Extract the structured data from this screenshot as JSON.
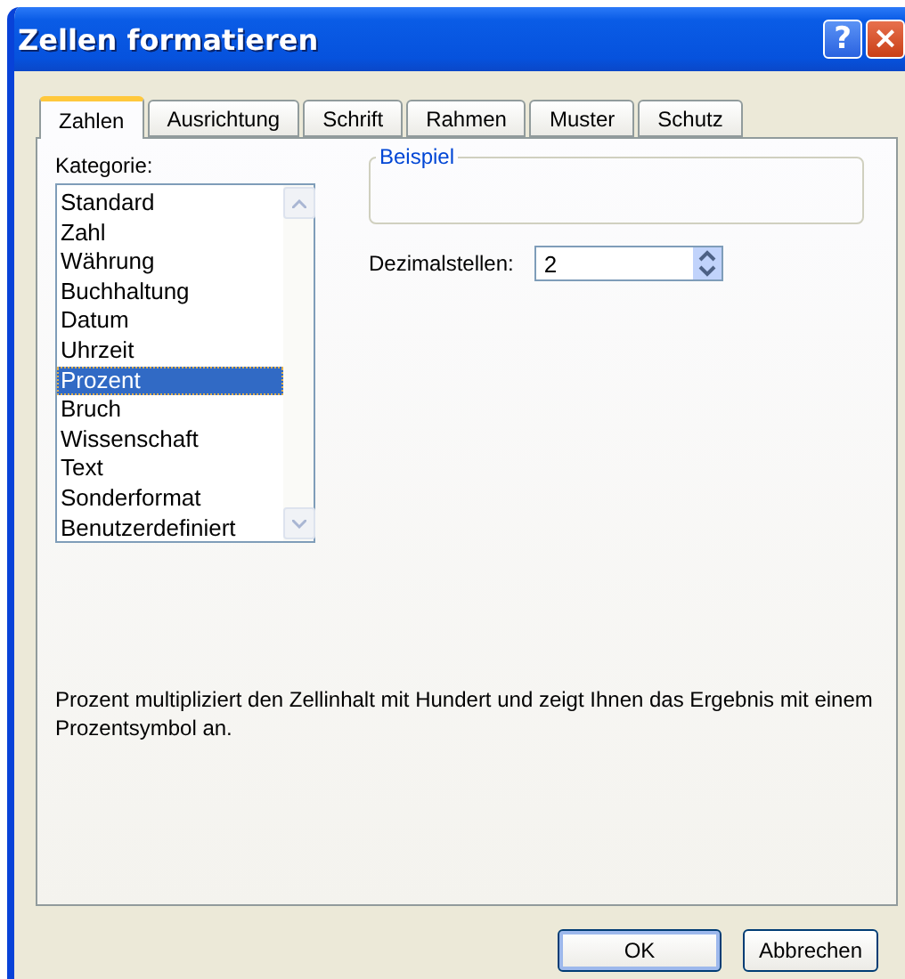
{
  "window": {
    "title": "Zellen formatieren"
  },
  "title_buttons": [
    {
      "kind": "help",
      "label": "?"
    },
    {
      "kind": "close",
      "label": "×"
    }
  ],
  "tabs": [
    {
      "label": "Zahlen",
      "selected": true
    },
    {
      "label": "Ausrichtung",
      "selected": false
    },
    {
      "label": "Schrift",
      "selected": false
    },
    {
      "label": "Rahmen",
      "selected": false
    },
    {
      "label": "Muster",
      "selected": false
    },
    {
      "label": "Schutz",
      "selected": false
    }
  ],
  "category": {
    "label": "Kategorie:",
    "items": [
      {
        "label": "Standard",
        "selected": false
      },
      {
        "label": "Zahl",
        "selected": false
      },
      {
        "label": "Währung",
        "selected": false
      },
      {
        "label": "Buchhaltung",
        "selected": false
      },
      {
        "label": "Datum",
        "selected": false
      },
      {
        "label": "Uhrzeit",
        "selected": false
      },
      {
        "label": "Prozent",
        "selected": true
      },
      {
        "label": "Bruch",
        "selected": false
      },
      {
        "label": "Wissenschaft",
        "selected": false
      },
      {
        "label": "Text",
        "selected": false
      },
      {
        "label": "Sonderformat",
        "selected": false
      },
      {
        "label": "Benutzerdefiniert",
        "selected": false
      }
    ]
  },
  "sample": {
    "title": "Beispiel"
  },
  "decimals": {
    "label": "Dezimalstellen:",
    "value": "2"
  },
  "description": "Prozent multipliziert den Zellinhalt mit Hundert und zeigt Ihnen das Ergebnis mit einem Prozentsymbol an.",
  "buttons": [
    {
      "label": "OK",
      "default": true
    },
    {
      "label": "Abbrechen",
      "default": false
    }
  ]
}
